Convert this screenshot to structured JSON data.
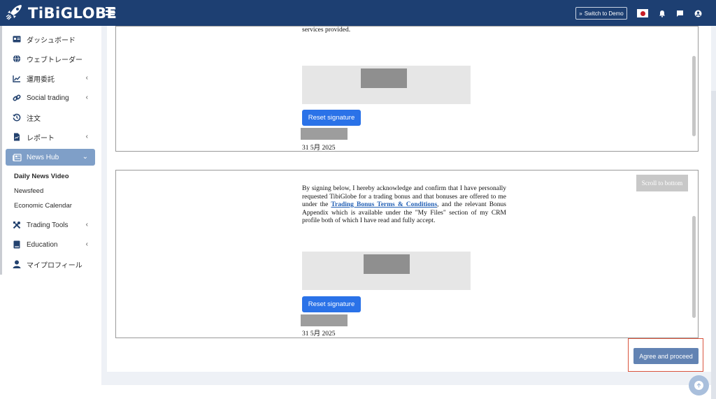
{
  "brand": {
    "name": "TiBiGLOBE"
  },
  "header": {
    "switch_demo_label": "Switch to Demo",
    "switch_demo_icon": "double-chevron-right-icon",
    "language_flag": "japan-flag-icon",
    "icons": [
      "bell-icon",
      "chat-icon",
      "user-icon"
    ],
    "colors": {
      "bar": "#1d3f72"
    }
  },
  "sidebar": {
    "items": [
      {
        "label": "ダッシュボード",
        "icon": "id-card-icon",
        "has_submenu": false
      },
      {
        "label": "ウェブトレーダー",
        "icon": "globe-icon",
        "has_submenu": false
      },
      {
        "label": "運用委託",
        "icon": "chart-line-icon",
        "has_submenu": true
      },
      {
        "label": "Social trading",
        "icon": "link-icon",
        "has_submenu": true
      },
      {
        "label": "注文",
        "icon": "history-icon",
        "has_submenu": false
      },
      {
        "label": "レポート",
        "icon": "report-file-icon",
        "has_submenu": true
      },
      {
        "label": "News Hub",
        "icon": "newspaper-icon",
        "has_submenu": true,
        "expanded": true
      },
      {
        "label": "Trading Tools",
        "icon": "tools-icon",
        "has_submenu": true
      },
      {
        "label": "Education",
        "icon": "book-icon",
        "has_submenu": true
      },
      {
        "label": "マイプロフィール",
        "icon": "user-icon",
        "has_submenu": false
      }
    ],
    "news_hub_subitems": [
      {
        "label": "Daily News Video",
        "current": true
      },
      {
        "label": "Newsfeed",
        "current": false
      },
      {
        "label": "Economic Calendar",
        "current": false
      }
    ],
    "active_color": "#7f9fc8"
  },
  "main": {
    "panel1": {
      "text_tail": "services provided.",
      "reset_label": "Reset signature",
      "date": "31 5月 2025"
    },
    "panel2": {
      "scroll_to_bottom_label": "Scroll to bottom",
      "text_before_link": "By signing below, I hereby acknowledge and confirm that I have personally requested TibiGlobe for a trading bonus and that bonuses are offered to me under the ",
      "link_text": "Trading Bonus Terms & Conditions",
      "text_after_link": ", and the relevant Bonus Appendix which is available under the \"My Files\" section of my CRM profile both of which I have read and fully accept.",
      "reset_label": "Reset signature",
      "date": "31 5月 2025"
    },
    "agree_label": "Agree and proceed",
    "accent": "#2a72e8",
    "agree_color": "#6283b3",
    "highlight_color": "#d9533d"
  },
  "floating": {
    "scroll_top_icon": "arrow-up-icon"
  }
}
